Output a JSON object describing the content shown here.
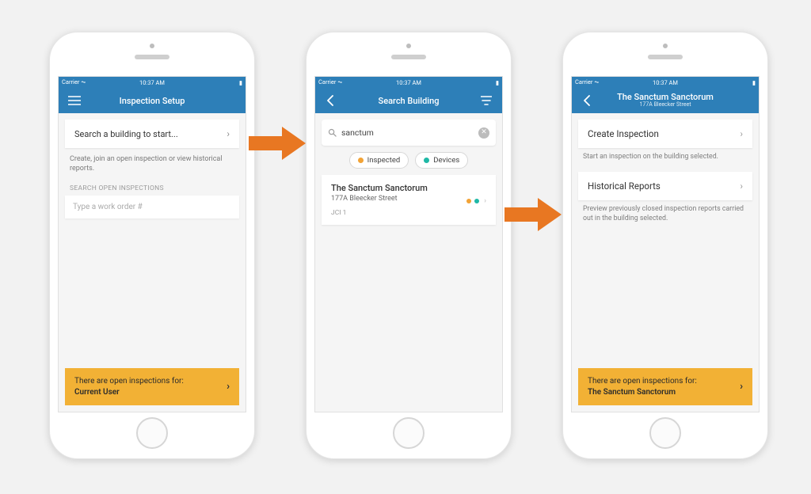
{
  "status": {
    "carrier": "Carrier",
    "signal": "▾",
    "wifi": "✶",
    "time": "10:37 AM",
    "battery": "■"
  },
  "screen1": {
    "title": "Inspection Setup",
    "search_prompt": "Search a building to start...",
    "helper": "Create, join an open inspection or view historical reports.",
    "section_label": "SEARCH OPEN INSPECTIONS",
    "work_order_placeholder": "Type a work order #",
    "banner_line1": "There are open inspections for:",
    "banner_line2": "Current User"
  },
  "screen2": {
    "title": "Search Building",
    "search_value": "sanctum",
    "chip_inspected": "Inspected",
    "chip_devices": "Devices",
    "result_title": "The Sanctum Sanctorum",
    "result_sub": "177A Bleecker Street",
    "result_meta": "JCI 1"
  },
  "screen3": {
    "title": "The Sanctum Sanctorum",
    "subtitle": "177A Bleecker Street",
    "create_label": "Create Inspection",
    "create_desc": "Start an inspection on the building selected.",
    "hist_label": "Historical Reports",
    "hist_desc": "Preview previously closed inspection reports carried out in the building selected.",
    "banner_line1": "There are open inspections for:",
    "banner_line2": "The Sanctum Sanctorum"
  }
}
